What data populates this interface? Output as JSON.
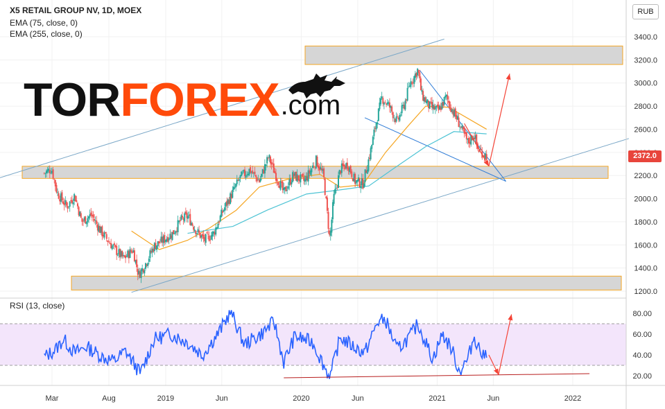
{
  "header": {
    "title": "X5 RETAIL GROUP NV, 1D, MOEX",
    "ema1": "EMA (75, close, 0)",
    "ema2": "EMA (255, close, 0)",
    "currency": "RUB",
    "rsi_label": "RSI (13, close)",
    "last_price": "2372.0"
  },
  "logo": {
    "part1": "TOR",
    "part2": "FOREX",
    "part3": ".com"
  },
  "colors": {
    "price_up": "#26a69a",
    "price_down": "#ef5350",
    "ema75": "#f5a623",
    "ema255": "#4dc3d4",
    "rsi_line": "#2962ff",
    "rsi_band": "#f3e5fb",
    "zone_fill": "#d6d6d6",
    "zone_border": "#f5a623",
    "trendline": "#7aa7c7",
    "arrow": "#f44336",
    "wedge": "#2e7bd6",
    "divergence": "#b71c1c",
    "logo_accent": "#ff4a0a"
  },
  "chart_data": [
    {
      "type": "candlestick",
      "title": "X5 RETAIL GROUP NV, 1D, MOEX",
      "x_tick_labels": [
        "Mar",
        "Aug",
        "2019",
        "Jun",
        "2020",
        "Jun",
        "2021",
        "Jun",
        "2022"
      ],
      "y_tick_labels": [
        "1200.0",
        "1400.0",
        "1600.0",
        "1800.0",
        "2000.0",
        "2200.0",
        "2400.0",
        "2600.0",
        "2800.0",
        "3000.0",
        "3200.0",
        "3400.0"
      ],
      "ylim": [
        1180,
        3540
      ],
      "grid": true,
      "price_path": [
        [
          "2018-02-08",
          2220
        ],
        [
          "2018-02-28",
          2260
        ],
        [
          "2018-03-15",
          2050
        ],
        [
          "2018-04-10",
          1930
        ],
        [
          "2018-05-01",
          2030
        ],
        [
          "2018-05-20",
          1800
        ],
        [
          "2018-06-15",
          1860
        ],
        [
          "2018-07-10",
          1720
        ],
        [
          "2018-08-15",
          1570
        ],
        [
          "2018-09-10",
          1480
        ],
        [
          "2018-10-05",
          1560
        ],
        [
          "2018-10-20",
          1340
        ],
        [
          "2018-11-05",
          1420
        ],
        [
          "2018-12-01",
          1590
        ],
        [
          "2018-12-20",
          1630
        ],
        [
          "2019-01-20",
          1700
        ],
        [
          "2019-02-10",
          1810
        ],
        [
          "2019-03-01",
          1850
        ],
        [
          "2019-03-25",
          1720
        ],
        [
          "2019-04-15",
          1640
        ],
        [
          "2019-05-10",
          1700
        ],
        [
          "2019-06-05",
          1900
        ],
        [
          "2019-06-25",
          2020
        ],
        [
          "2019-07-20",
          2180
        ],
        [
          "2019-08-15",
          2250
        ],
        [
          "2019-09-10",
          2150
        ],
        [
          "2019-10-05",
          2360
        ],
        [
          "2019-10-25",
          2200
        ],
        [
          "2019-11-15",
          2050
        ],
        [
          "2019-12-10",
          2200
        ],
        [
          "2020-01-10",
          2150
        ],
        [
          "2020-02-10",
          2330
        ],
        [
          "2020-03-01",
          2200
        ],
        [
          "2020-03-18",
          1640
        ],
        [
          "2020-03-28",
          2000
        ],
        [
          "2020-04-15",
          2250
        ],
        [
          "2020-05-05",
          2300
        ],
        [
          "2020-05-25",
          2150
        ],
        [
          "2020-06-15",
          2130
        ],
        [
          "2020-07-05",
          2400
        ],
        [
          "2020-07-20",
          2650
        ],
        [
          "2020-08-05",
          2870
        ],
        [
          "2020-08-25",
          2800
        ],
        [
          "2020-09-15",
          2660
        ],
        [
          "2020-10-05",
          2820
        ],
        [
          "2020-10-20",
          3000
        ],
        [
          "2020-11-01",
          3060
        ],
        [
          "2020-11-10",
          3120
        ],
        [
          "2020-11-20",
          2900
        ],
        [
          "2020-12-10",
          2800
        ],
        [
          "2021-01-05",
          2760
        ],
        [
          "2021-01-25",
          2880
        ],
        [
          "2021-02-10",
          2770
        ],
        [
          "2021-02-25",
          2680
        ],
        [
          "2021-03-10",
          2580
        ],
        [
          "2021-03-25",
          2480
        ],
        [
          "2021-04-10",
          2560
        ],
        [
          "2021-04-20",
          2430
        ],
        [
          "2021-05-05",
          2390
        ],
        [
          "2021-05-14",
          2372
        ]
      ],
      "series": [
        {
          "name": "EMA (75, close, 0)",
          "values": [
            [
              "2018-10-01",
              1720
            ],
            [
              "2018-12-15",
              1560
            ],
            [
              "2019-03-01",
              1640
            ],
            [
              "2019-05-01",
              1750
            ],
            [
              "2019-07-10",
              1900
            ],
            [
              "2019-09-10",
              2100
            ],
            [
              "2019-12-10",
              2180
            ],
            [
              "2020-02-20",
              2210
            ],
            [
              "2020-04-15",
              2100
            ],
            [
              "2020-06-15",
              2120
            ],
            [
              "2020-08-15",
              2400
            ],
            [
              "2020-10-15",
              2630
            ],
            [
              "2020-12-01",
              2800
            ],
            [
              "2021-02-01",
              2790
            ],
            [
              "2021-05-14",
              2600
            ]
          ]
        },
        {
          "name": "EMA (255, close, 0)",
          "values": [
            [
              "2019-03-01",
              1700
            ],
            [
              "2019-07-01",
              1760
            ],
            [
              "2019-10-01",
              1900
            ],
            [
              "2020-01-15",
              2040
            ],
            [
              "2020-04-01",
              2070
            ],
            [
              "2020-07-01",
              2110
            ],
            [
              "2020-09-01",
              2250
            ],
            [
              "2020-12-01",
              2450
            ],
            [
              "2021-02-15",
              2580
            ],
            [
              "2021-05-14",
              2560
            ]
          ]
        }
      ],
      "zones": [
        [
          3160,
          3320
        ],
        [
          2175,
          2280
        ],
        [
          1210,
          1330
        ]
      ],
      "trendlines": [
        [
          [
            "2017-09-01",
            2140
          ],
          [
            "2021-01-20",
            3380
          ]
        ],
        [
          [
            "2018-10-01",
            1190
          ],
          [
            "2022-06-01",
            2520
          ]
        ],
        [
          [
            "2020-11-15",
            3110
          ],
          [
            "2021-07-05",
            2150
          ]
        ],
        [
          [
            "2020-06-20",
            2700
          ],
          [
            "2021-07-05",
            2150
          ]
        ]
      ],
      "arrows": [
        [
          [
            "2021-03-15",
            2650
          ],
          [
            "2021-05-20",
            2280
          ]
        ],
        [
          [
            "2021-05-20",
            2280
          ],
          [
            "2021-07-15",
            3080
          ]
        ]
      ]
    },
    {
      "type": "line",
      "title": "RSI (13, close)",
      "y_tick_labels": [
        "20.00",
        "40.00",
        "60.00",
        "80.00"
      ],
      "ylim": [
        15,
        86
      ],
      "band": [
        30,
        70
      ],
      "rsi_path": [
        [
          "2018-02-08",
          38
        ],
        [
          "2018-03-10",
          45
        ],
        [
          "2018-04-01",
          55
        ],
        [
          "2018-05-01",
          42
        ],
        [
          "2018-06-01",
          48
        ],
        [
          "2018-07-15",
          38
        ],
        [
          "2018-08-15",
          34
        ],
        [
          "2018-09-15",
          44
        ],
        [
          "2018-10-25",
          22
        ],
        [
          "2018-12-01",
          55
        ],
        [
          "2019-01-15",
          60
        ],
        [
          "2019-03-01",
          52
        ],
        [
          "2019-04-10",
          40
        ],
        [
          "2019-05-25",
          62
        ],
        [
          "2019-06-25",
          82
        ],
        [
          "2019-08-01",
          50
        ],
        [
          "2019-09-15",
          60
        ],
        [
          "2019-10-20",
          72
        ],
        [
          "2019-11-15",
          33
        ],
        [
          "2019-12-15",
          58
        ],
        [
          "2020-02-01",
          52
        ],
        [
          "2020-03-18",
          18
        ],
        [
          "2020-04-15",
          57
        ],
        [
          "2020-05-20",
          48
        ],
        [
          "2020-06-20",
          42
        ],
        [
          "2020-07-25",
          72
        ],
        [
          "2020-08-15",
          74
        ],
        [
          "2020-09-15",
          45
        ],
        [
          "2020-10-20",
          58
        ],
        [
          "2020-11-10",
          70
        ],
        [
          "2020-12-20",
          36
        ],
        [
          "2021-01-15",
          60
        ],
        [
          "2021-02-10",
          45
        ],
        [
          "2021-03-01",
          24
        ],
        [
          "2021-03-25",
          36
        ],
        [
          "2021-04-10",
          58
        ],
        [
          "2021-05-05",
          38
        ],
        [
          "2021-05-14",
          43
        ]
      ],
      "divergence_line": [
        [
          "2019-11-15",
          18
        ],
        [
          "2022-02-15",
          22
        ]
      ],
      "arrows": [
        [
          [
            "2021-05-20",
            40
          ],
          [
            "2021-06-15",
            21
          ]
        ],
        [
          [
            "2021-06-15",
            21
          ],
          [
            "2021-07-20",
            79
          ]
        ]
      ]
    }
  ]
}
